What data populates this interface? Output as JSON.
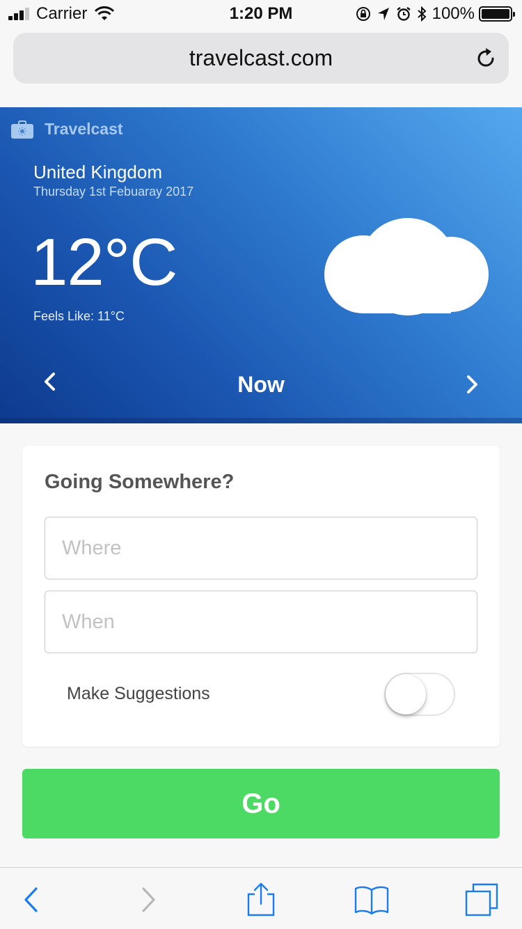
{
  "status_bar": {
    "carrier": "Carrier",
    "time": "1:20 PM",
    "battery_percent": "100%",
    "battery_level": 1.0,
    "icons": [
      "signal-icon",
      "wifi-icon",
      "orientation-lock-icon",
      "location-icon",
      "alarm-icon",
      "bluetooth-icon",
      "battery-icon"
    ]
  },
  "browser": {
    "url": "travelcast.com",
    "icons": [
      "reload-icon"
    ]
  },
  "app": {
    "name": "Travelcast",
    "brand_icon": "briefcase-sun-icon"
  },
  "weather": {
    "location": "United Kingdom",
    "date": "Thursday 1st Febuaray 2017",
    "temperature": "12°C",
    "feels_like": "Feels Like: 11°C",
    "period": "Now",
    "condition_icon": "cloud-icon",
    "colors": {
      "gradient_light": "#55a8ee",
      "gradient_dark": "#0d3a8e"
    }
  },
  "planner": {
    "title": "Going Somewhere?",
    "where_placeholder": "Where",
    "where_value": "",
    "when_placeholder": "When",
    "when_value": "",
    "suggestions_label": "Make Suggestions",
    "suggestions_enabled": false,
    "go_label": "Go",
    "go_color": "#4cd964"
  },
  "toolbar": {
    "items": [
      "back-icon",
      "forward-icon",
      "share-icon",
      "bookmarks-icon",
      "tabs-icon"
    ],
    "accent": "#1a7cf0"
  }
}
